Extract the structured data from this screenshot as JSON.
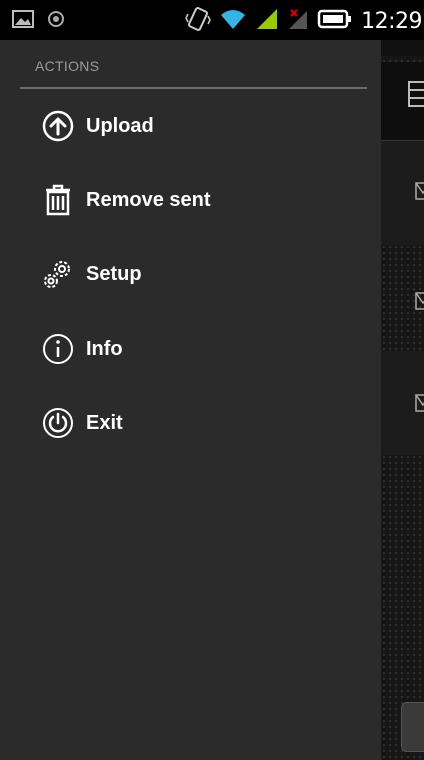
{
  "status_bar": {
    "time": "12:29",
    "icons": [
      "image-notification-icon",
      "shield-notification-icon",
      "vibrate-icon",
      "wifi-icon",
      "signal-icon",
      "no-sim-signal-icon",
      "battery-icon"
    ]
  },
  "drawer": {
    "section_title": "ACTIONS",
    "items": [
      {
        "label": "Upload",
        "icon": "upload-icon"
      },
      {
        "label": "Remove sent",
        "icon": "trash-icon"
      },
      {
        "label": "Setup",
        "icon": "gears-icon"
      },
      {
        "label": "Info",
        "icon": "info-icon"
      },
      {
        "label": "Exit",
        "icon": "power-icon"
      }
    ]
  },
  "colors": {
    "drawer_bg": "#2b2b2b",
    "statusbar_bg": "#000000",
    "accent_wifi": "#33b5e5",
    "accent_signal": "#99cc00",
    "no_sim": "#cc0000"
  }
}
